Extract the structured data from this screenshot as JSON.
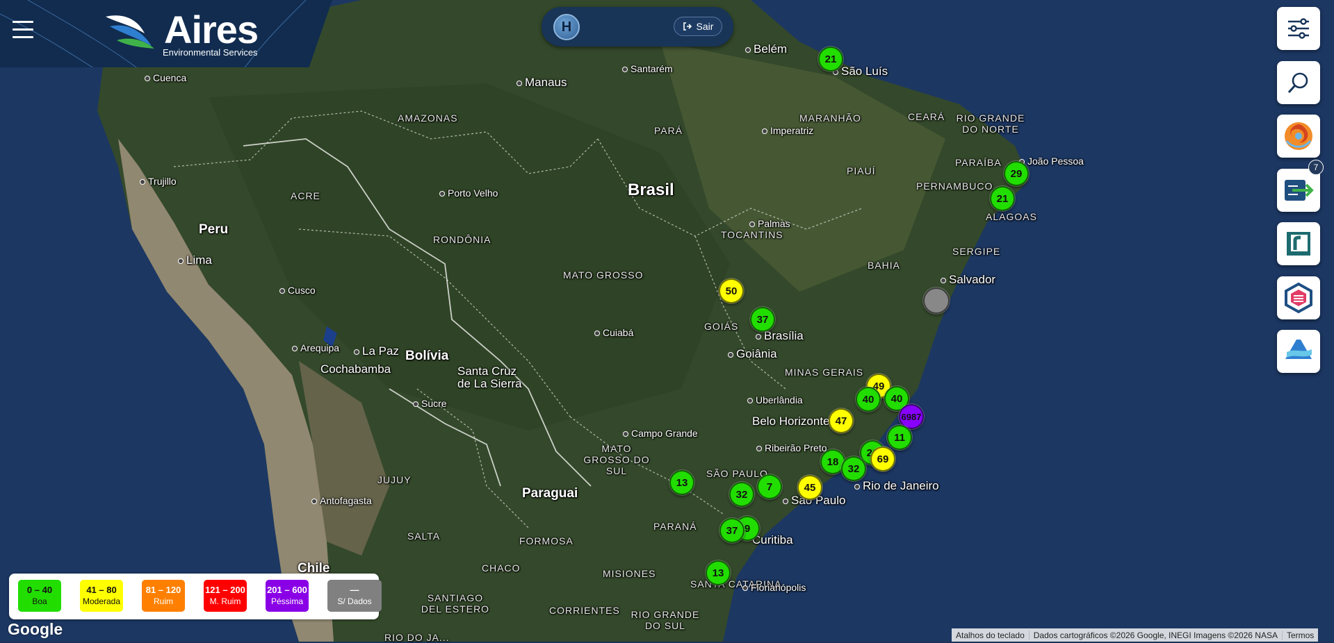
{
  "header": {
    "brand": "Aires",
    "tagline": "Environmental Services"
  },
  "user": {
    "avatar_initial": "H",
    "logout_label": "Sair"
  },
  "toolbar": {
    "buttons": [
      {
        "name": "filters-button",
        "icon": "sliders-icon"
      },
      {
        "name": "search-button",
        "icon": "search-icon"
      },
      {
        "name": "layer-weather-button",
        "icon": "hurricane-icon"
      },
      {
        "name": "layer-export-button",
        "icon": "export-icon"
      },
      {
        "name": "layer-reports-button",
        "icon": "report-icon"
      },
      {
        "name": "layer-monitoring-button",
        "icon": "shield-icon"
      },
      {
        "name": "layer-aires-button",
        "icon": "aires-logo-icon"
      }
    ],
    "notification_count": "7"
  },
  "colors": {
    "good": "#22dd00",
    "moderate": "#ffff00",
    "bad": "#ff8800",
    "very_bad": "#ff1a1a",
    "terrible": "#8800ff",
    "no_data": "#888888"
  },
  "legend": [
    {
      "range": "0 – 40",
      "label": "Boa",
      "color": "#22dd00",
      "text": "#111"
    },
    {
      "range": "41 – 80",
      "label": "Moderada",
      "color": "#ffff00",
      "text": "#111"
    },
    {
      "range": "81 – 120",
      "label": "Ruim",
      "color": "#ff8000",
      "text": "#fff"
    },
    {
      "range": "121 – 200",
      "label": "M. Ruim",
      "color": "#ff0000",
      "text": "#fff"
    },
    {
      "range": "201 – 600",
      "label": "Péssima",
      "color": "#8a00e6",
      "text": "#fff"
    },
    {
      "range": "—",
      "label": "S/ Dados",
      "color": "#808080",
      "text": "#fff"
    }
  ],
  "map": {
    "countries": [
      "Brasil",
      "Peru",
      "Bolívia",
      "Paraguai",
      "Chile"
    ],
    "states": [
      "AMAZONAS",
      "PARÁ",
      "MARANHÃO",
      "CEARÁ",
      "RIO GRANDE DO NORTE",
      "PARAÍBA",
      "PERNAMBUCO",
      "ALAGOAS",
      "SERGIPE",
      "PIAUÍ",
      "BAHIA",
      "ACRE",
      "RONDÔNIA",
      "MATO GROSSO",
      "TOCANTINS",
      "GOIÁS",
      "MINAS GERAIS",
      "MATO GROSSO DO SUL",
      "SÃO PAULO",
      "PARANÁ",
      "SANTA CATARINA",
      "RIO GRANDE DO SUL",
      "JUJUY",
      "SALTA",
      "FORMOSA",
      "CHACO",
      "MISIONES",
      "CORRIENTES",
      "SANTIAGO DEL ESTERO",
      "RIO DO JA..."
    ],
    "cities": [
      "Belém",
      "São Luís",
      "Santarém",
      "Manaus",
      "Imperatriz",
      "João Pessoa",
      "Porto Velho",
      "Palmas",
      "Salvador",
      "Lima",
      "Cusco",
      "Trujillo",
      "Cuenca",
      "Arequipa",
      "La Paz",
      "Cochabamba",
      "Santa Cruz de La Sierra",
      "Sucre",
      "Cuiabá",
      "Brasília",
      "Goiânia",
      "Uberlândia",
      "Belo Horizonte",
      "Campo Grande",
      "Ribeirão Preto",
      "Rio de Janeiro",
      "São Paulo",
      "Curitiba",
      "Florianópolis",
      "Antofagasta"
    ],
    "markers": [
      {
        "value": "21",
        "level": "good"
      },
      {
        "value": "29",
        "level": "good"
      },
      {
        "value": "21",
        "level": "good"
      },
      {
        "value": "50",
        "level": "moderate"
      },
      {
        "value": "37",
        "level": "good"
      },
      {
        "value": "",
        "level": "no_data"
      },
      {
        "value": "49",
        "level": "moderate"
      },
      {
        "value": "40",
        "level": "good"
      },
      {
        "value": "40",
        "level": "good"
      },
      {
        "value": "6987",
        "level": "terrible"
      },
      {
        "value": "47",
        "level": "moderate"
      },
      {
        "value": "11",
        "level": "good"
      },
      {
        "value": "20",
        "level": "good"
      },
      {
        "value": "69",
        "level": "moderate"
      },
      {
        "value": "18",
        "level": "good"
      },
      {
        "value": "32",
        "level": "good"
      },
      {
        "value": "13",
        "level": "good"
      },
      {
        "value": "7",
        "level": "good"
      },
      {
        "value": "45",
        "level": "moderate"
      },
      {
        "value": "32",
        "level": "good"
      },
      {
        "value": "9",
        "level": "good"
      },
      {
        "value": "37",
        "level": "good"
      },
      {
        "value": "13",
        "level": "good"
      }
    ]
  },
  "footer": {
    "google": "Google",
    "shortcuts": "Atalhos do teclado",
    "data_credit": "Dados cartográficos ©2026 Google, INEGI Imagens ©2026 NASA",
    "terms": "Termos"
  }
}
